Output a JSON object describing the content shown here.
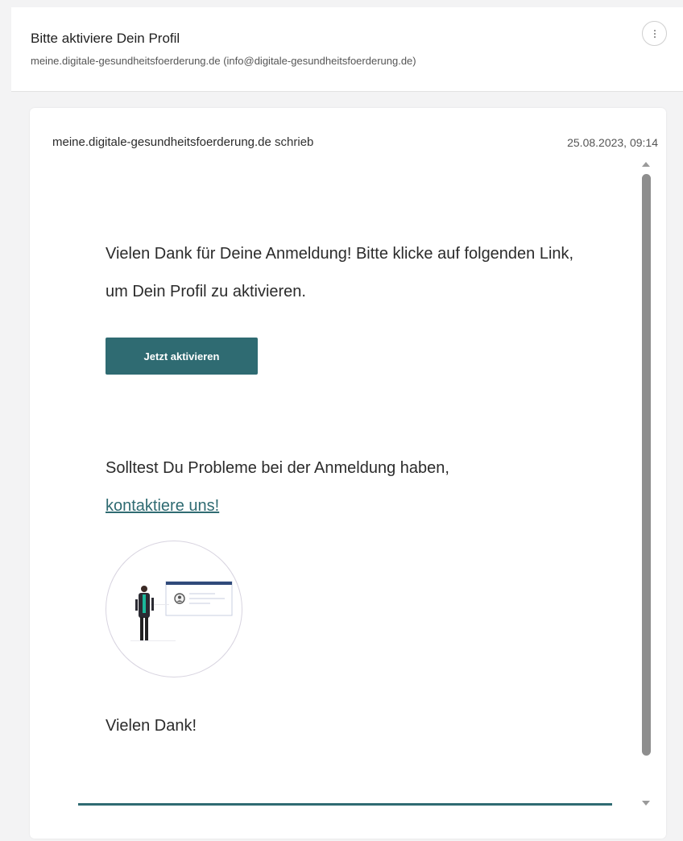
{
  "header": {
    "subject": "Bitte aktiviere Dein Profil",
    "sender": "meine.digitale-gesundheitsfoerderung.de (info@digitale-gesundheitsfoerderung.de)",
    "menu_icon": "more-vertical-icon"
  },
  "message": {
    "from_domain": "meine.digitale-gesundheitsfoerderung.de",
    "from_suffix": " schrieb",
    "date": "25.08.2023, 09:14",
    "paragraph1": "Vielen Dank für Deine Anmeldung! Bitte klicke auf folgenden Link, um Dein Profil zu aktivieren.",
    "cta_label": "Jetzt aktivieren",
    "paragraph2_text": "Solltest Du Probleme bei der Anmeldung haben, ",
    "paragraph2_link": "kontaktiere uns!",
    "thanks": "Vielen Dank!"
  },
  "colors": {
    "accent": "#2f6b72",
    "scrollbar": "#8e8e8e"
  }
}
